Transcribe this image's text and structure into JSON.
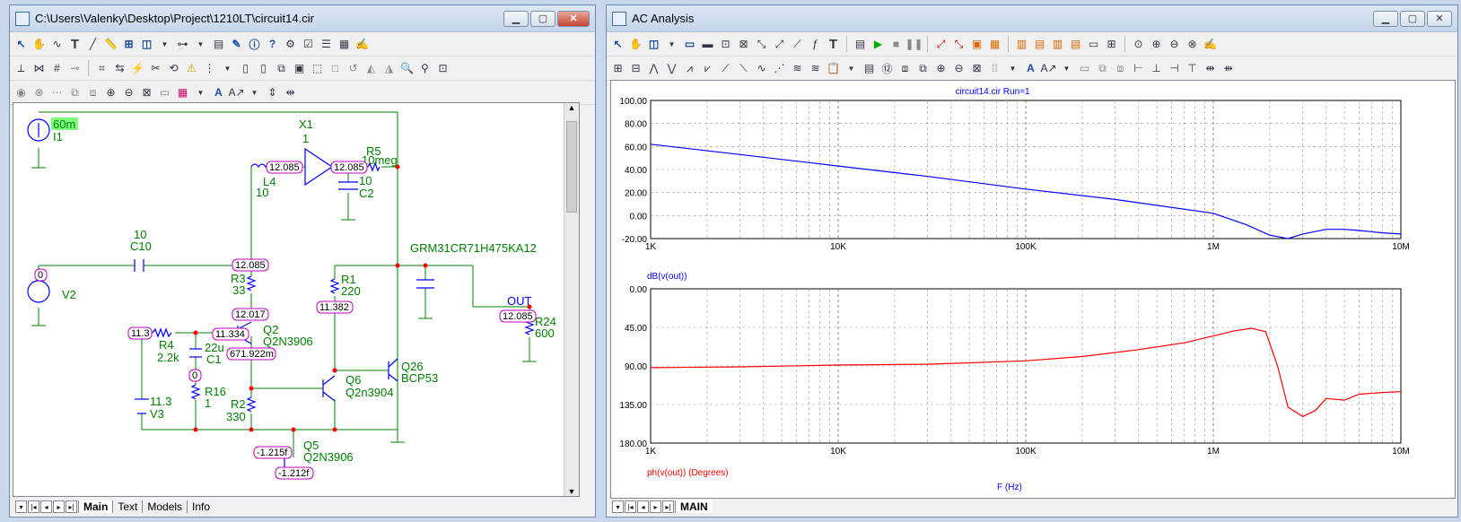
{
  "left_window": {
    "title": "C:\\Users\\Valenky\\Desktop\\Project\\1210LT\\circuit14.cir",
    "tabs": [
      "Main",
      "Text",
      "Models",
      "Info"
    ],
    "schematic": {
      "I1": {
        "value": "60m",
        "name": "I1"
      },
      "X1": {
        "name": "X1",
        "gain": "1"
      },
      "R5": {
        "name": "R5",
        "value": "10meg"
      },
      "L4": {
        "name": "L4",
        "value": "10"
      },
      "C2": {
        "name": "C2",
        "value": "10"
      },
      "C10": {
        "name": "C10",
        "value": "10"
      },
      "V2": {
        "name": "V2",
        "value": "0"
      },
      "part_label": "GRM31CR71H475KA12",
      "R3": {
        "name": "R3",
        "value": "33"
      },
      "R1": {
        "name": "R1",
        "value": "220"
      },
      "Q2": {
        "name": "Q2",
        "model": "Q2N3906"
      },
      "R4": {
        "name": "R4",
        "value": "2.2k"
      },
      "C1": {
        "name": "C1",
        "value": "22u"
      },
      "R16": {
        "name": "R16",
        "value": "1"
      },
      "V3": {
        "name": "V3",
        "value": "11.3"
      },
      "R2": {
        "name": "R2",
        "value": "330"
      },
      "Q6": {
        "name": "Q6",
        "model": "Q2n3904"
      },
      "Q26": {
        "name": "Q26",
        "model": "BCP53"
      },
      "Q5": {
        "name": "Q5",
        "model": "Q2N3906"
      },
      "R24": {
        "name": "R24",
        "value": "600"
      },
      "out_label": "OUT",
      "node_values": {
        "n1": "12.085",
        "n2": "12.085",
        "n3": "12.085",
        "n4": "12.017",
        "n5": "11.334",
        "n6": "671.922m",
        "n7": "11.3",
        "n8": "0",
        "n9": "11.382",
        "n10": "12.085",
        "n11": "-1.215f",
        "n12": "-1.212f",
        "n13": "0"
      }
    }
  },
  "right_window": {
    "title": "AC Analysis",
    "tabs": [
      "MAIN"
    ],
    "plot_title": "circuit14.cir Run=1",
    "xlabel": "F (Hz)",
    "x_ticks": [
      "1K",
      "10K",
      "100K",
      "1M",
      "10M"
    ],
    "top_plot": {
      "label": "dB(v(out))",
      "y_ticks": [
        "100.00",
        "80.00",
        "60.00",
        "40.00",
        "20.00",
        "0.00",
        "-20.00"
      ],
      "color": "#0000ff"
    },
    "bottom_plot": {
      "label": "ph(v(out)) (Degrees)",
      "y_ticks": [
        "0.00",
        "45.00",
        "90.00",
        "135.00",
        "180.00"
      ],
      "color": "#ff0000"
    }
  },
  "chart_data": [
    {
      "type": "line",
      "title": "circuit14.cir Run=1",
      "xlabel": "F (Hz)",
      "ylabel": "dB(v(out))",
      "xscale": "log",
      "xlim": [
        1000,
        10000000
      ],
      "ylim": [
        -20,
        100
      ],
      "grid": true,
      "series": [
        {
          "name": "dB(v(out))",
          "color": "#0000ff",
          "x": [
            1000,
            3000,
            10000,
            30000,
            100000,
            300000,
            1000000,
            1500000,
            2000000,
            2500000,
            3000000,
            4000000,
            5000000,
            6000000,
            8000000,
            10000000
          ],
          "y": [
            62,
            53,
            43,
            34,
            23,
            14,
            2,
            -8,
            -17,
            -20,
            -16,
            -12,
            -12,
            -13,
            -15,
            -16
          ]
        }
      ]
    },
    {
      "type": "line",
      "xlabel": "F (Hz)",
      "ylabel": "ph(v(out)) (Degrees)",
      "xscale": "log",
      "xlim": [
        1000,
        10000000
      ],
      "ylim": [
        0,
        180
      ],
      "y_inverted": true,
      "grid": true,
      "series": [
        {
          "name": "ph(v(out)) (Degrees)",
          "color": "#ff0000",
          "x": [
            1000,
            3000,
            10000,
            30000,
            100000,
            200000,
            400000,
            700000,
            1000000,
            1300000,
            1600000,
            1900000,
            2200000,
            2500000,
            3000000,
            3500000,
            4000000,
            5000000,
            6000000,
            8000000,
            10000000
          ],
          "y": [
            92,
            91,
            89,
            88,
            84,
            79,
            71,
            63,
            55,
            49,
            46,
            50,
            90,
            138,
            149,
            142,
            128,
            130,
            123,
            121,
            120
          ]
        }
      ]
    }
  ]
}
